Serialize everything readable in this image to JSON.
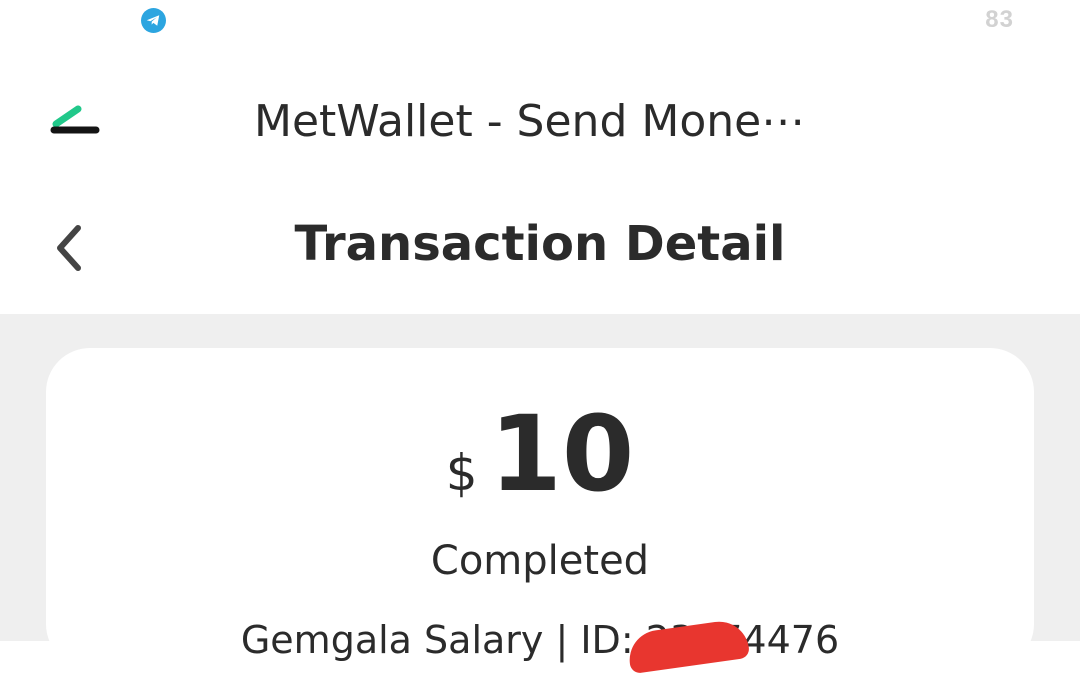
{
  "status_bar": {
    "notification_icon": "telegram-icon",
    "battery_level": "83"
  },
  "app_bar": {
    "logo_icon": "metwallet-logo-icon",
    "title": "MetWallet - Send Mone⋯"
  },
  "nav": {
    "back_icon": "chevron-left-icon",
    "title": "Transaction Detail"
  },
  "transaction": {
    "currency_symbol": "$",
    "amount": "10",
    "status": "Completed",
    "description": "Gemgala Salary | ID: 23074476"
  },
  "colors": {
    "background": "#efefef",
    "card": "#ffffff",
    "text": "#2b2b2b",
    "logo_green": "#21c88a",
    "telegram_blue": "#2ca5e0",
    "redaction": "#e8362f"
  }
}
